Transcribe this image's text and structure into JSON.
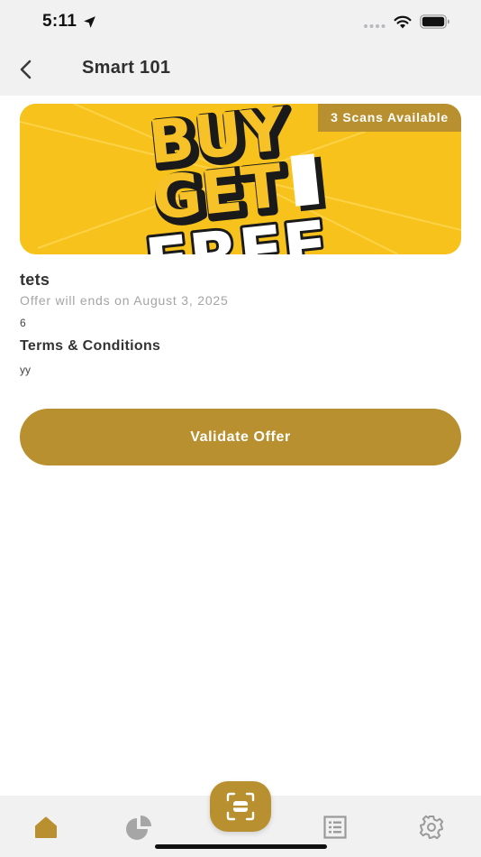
{
  "status_bar": {
    "time": "5:11",
    "icons": [
      "location-arrow-icon",
      "signal-dots-icon",
      "wifi-icon",
      "battery-icon"
    ]
  },
  "header": {
    "title": "Smart 101",
    "back_icon": "chevron-left-icon"
  },
  "banner": {
    "image_text": [
      "BUY",
      "GET",
      "FREE"
    ],
    "badge": "3 Scans Available"
  },
  "offer": {
    "title": "tets",
    "end_text": "Offer will ends on August 3, 2025",
    "value": "6"
  },
  "terms": {
    "heading": "Terms & Conditions",
    "text": "yy"
  },
  "actions": {
    "validate_label": "Validate Offer"
  },
  "tab_bar": {
    "items": [
      {
        "icon": "home-icon",
        "active": true
      },
      {
        "icon": "pie-chart-icon",
        "active": false
      },
      {
        "icon": "scan-icon",
        "active": false
      },
      {
        "icon": "list-icon",
        "active": false
      },
      {
        "icon": "gear-icon",
        "active": false
      }
    ]
  },
  "colors": {
    "accent": "#b8902f",
    "banner_yellow": "#f6c21b",
    "background": "#ffffff",
    "bar_background": "#f1f1f2",
    "muted_text": "#a4a4a4"
  }
}
